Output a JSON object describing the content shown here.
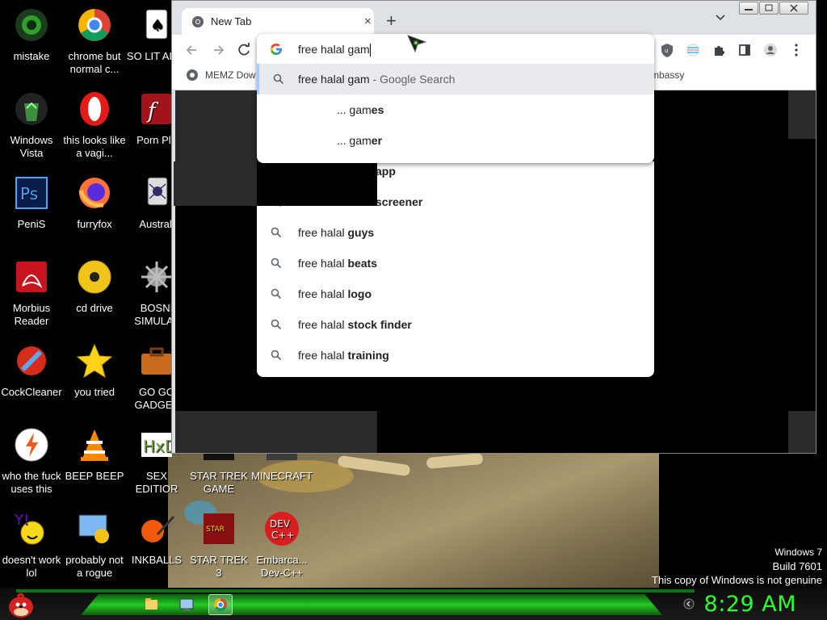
{
  "desktop": {
    "icons": [
      {
        "label": "mistake",
        "icon": "green-mask-icon"
      },
      {
        "label": "chrome but normal c...",
        "icon": "chrome-icon"
      },
      {
        "label": "SO LIT AIRE",
        "icon": "solitaire-icon"
      },
      {
        "label": "Windows Vista",
        "icon": "recycle-bin-icon"
      },
      {
        "label": "this looks like a vagi...",
        "icon": "opera-icon"
      },
      {
        "label": "Porn Pla",
        "icon": "flash-icon"
      },
      {
        "label": "PeniS",
        "icon": "photoshop-icon"
      },
      {
        "label": "furryfox",
        "icon": "firefox-icon"
      },
      {
        "label": "Australi",
        "icon": "spider-solitaire-icon"
      },
      {
        "label": "Morbius Reader",
        "icon": "acrobat-icon"
      },
      {
        "label": "cd drive",
        "icon": "cd-icon"
      },
      {
        "label": "BOSNI SIMULAT",
        "icon": "mine-icon"
      },
      {
        "label": "CockCleaner",
        "icon": "ccleaner-icon"
      },
      {
        "label": "you tried",
        "icon": "star-icon"
      },
      {
        "label": "GO GO GADGET",
        "icon": "briefcase-icon"
      },
      {
        "label": "who the fuck uses this",
        "icon": "power-icon"
      },
      {
        "label": "BEEP BEEP",
        "icon": "vlc-icon"
      },
      {
        "label": "SEX EDITIOR",
        "icon": "hex-editor-icon"
      },
      {
        "label": "doesn't work lol",
        "icon": "yahoo-messenger-icon"
      },
      {
        "label": "probably not a rogue",
        "icon": "settings-monitor-icon"
      },
      {
        "label": "INKBALLS",
        "icon": "inkball-icon"
      },
      {
        "label": "STAR TREK GAME",
        "icon": "star-wars-icon"
      },
      {
        "label": "MINECRAFT",
        "icon": "minecraft-icon"
      },
      {
        "label": "STAR TREK 3",
        "icon": "star-wars-3-icon"
      },
      {
        "label": "Embarca... Dev-C++",
        "icon": "devcpp-icon"
      }
    ]
  },
  "watermark": {
    "line1": "Windows 7",
    "line2": "Build 7601",
    "line3": "This copy of Windows is not genuine"
  },
  "taskbar": {
    "clock": "8:29 AM",
    "pinned": [
      "explorer-icon",
      "desktop-icon",
      "chrome-icon"
    ]
  },
  "browser": {
    "tab_title": "New Tab",
    "new_tab": "+",
    "close_tab": "×",
    "bookmarks": [
      "MEMZ Dow",
      "mbassy"
    ],
    "omnibox": {
      "value": "free halal gam",
      "selected": {
        "text": "free halal gam",
        "suffix": " - Google Search"
      },
      "suggestions": [
        {
          "prefix": "... gam",
          "bold": "es"
        },
        {
          "prefix": "... gam",
          "bold": "er"
        }
      ]
    },
    "underlying_suggestions": [
      {
        "prefix": "",
        "bold": "app"
      },
      {
        "prefix": "",
        "bold": "screener"
      },
      {
        "prefix": "free halal ",
        "bold": "guys"
      },
      {
        "prefix": "free halal ",
        "bold": "beats"
      },
      {
        "prefix": "free halal ",
        "bold": "logo"
      },
      {
        "prefix": "free halal ",
        "bold": "stock finder"
      },
      {
        "prefix": "free halal ",
        "bold": "training"
      }
    ]
  },
  "colors": {
    "clock": "#2bff2b",
    "taskbar_glow": "#22c922",
    "chrome_frame": "#dee1e6"
  }
}
